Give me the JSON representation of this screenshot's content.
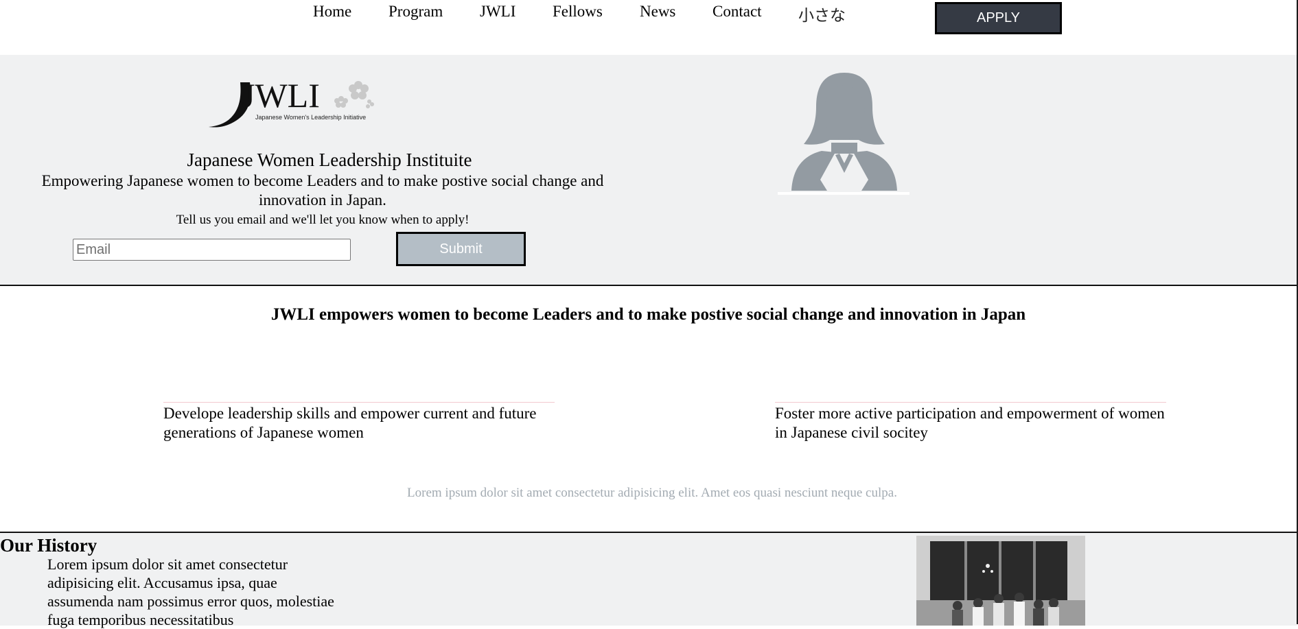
{
  "nav": {
    "items": [
      {
        "label": "Home"
      },
      {
        "label": "Program"
      },
      {
        "label": "JWLI"
      },
      {
        "label": "Fellows"
      },
      {
        "label": "News"
      },
      {
        "label": "Contact"
      },
      {
        "label": "小さな"
      }
    ],
    "apply_label": "APPLY"
  },
  "hero": {
    "logo_text": "JWLI",
    "logo_subtitle": "Japanese Women's Leadership Initiative",
    "title": "Japanese Women Leadership Instituite",
    "subtitle": "Empowering Japanese women to become Leaders and to make postive social change and innovation in Japan.",
    "note": "Tell us you email and we'll let you know when to apply!",
    "email_placeholder": "Email",
    "submit_label": "Submit",
    "avatar_icon": "woman-silhouette-icon"
  },
  "mission": {
    "heading": "JWLI empowers women to become Leaders and to make postive social change and innovation in Japan",
    "goals": [
      {
        "text": "Develope leadership skills and empower current and future generations of Japanese women"
      },
      {
        "text": "Foster more active participation and empowerment of women in Japanese civil socitey"
      }
    ],
    "lorem": "Lorem ipsum dolor sit amet consectetur adipisicing elit. Amet eos quasi nesciunt neque culpa."
  },
  "history": {
    "title": "Our History",
    "body": "Lorem ipsum dolor sit amet consectetur adipisicing elit. Accusamus ipsa, quae assumenda nam possimus error quos, molestiae fuga temporibus necessitatibus"
  },
  "colors": {
    "apply_bg": "#353a44",
    "hero_bg": "#f0f1f2",
    "submit_bg": "#b4bec6",
    "muted_text": "#a3abb2",
    "goal_rule": "#f2c9cf"
  }
}
